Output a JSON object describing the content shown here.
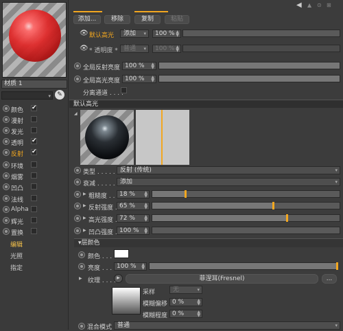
{
  "left": {
    "material_name": "材质 1",
    "channels": [
      {
        "label": "颜色",
        "checked": true,
        "active": false
      },
      {
        "label": "漫射",
        "checked": false,
        "active": false
      },
      {
        "label": "发光",
        "checked": false,
        "active": false
      },
      {
        "label": "透明",
        "checked": true,
        "active": false
      },
      {
        "label": "反射",
        "checked": true,
        "active": true
      },
      {
        "label": "环境",
        "checked": false,
        "active": false
      },
      {
        "label": "烟雾",
        "checked": false,
        "active": false
      },
      {
        "label": "凹凸",
        "checked": false,
        "active": false
      },
      {
        "label": "法线",
        "checked": false,
        "active": false
      },
      {
        "label": "Alpha",
        "checked": false,
        "active": false
      },
      {
        "label": "辉光",
        "checked": false,
        "active": false
      },
      {
        "label": "置换",
        "checked": false,
        "active": false
      }
    ],
    "sub_items": [
      "编辑",
      "光照",
      "指定"
    ],
    "selected_sub": "编辑"
  },
  "toolbar": {
    "add": "添加...",
    "remove": "移除",
    "copy": "复制",
    "paste": "粘贴"
  },
  "layers": {
    "layer1": {
      "name": "默认高光",
      "mode": "添加",
      "percent": "100 %"
    },
    "layer2": {
      "name": "* 透明度 *",
      "mode": "普通",
      "percent": "100 %"
    }
  },
  "global": {
    "reflection_label": "全局反射亮度",
    "reflection_value": "100 %",
    "specular_label": "全局高光亮度",
    "specular_value": "100 %",
    "separate_label": "分离通道 . . . ."
  },
  "layer_section": {
    "title": "默认高光"
  },
  "props": {
    "type_label": "类型 . . . . .",
    "type_value": "反射 (传统)",
    "atten_label": "衰减 . . . . .",
    "atten_value": "添加",
    "rough_label": "粗糙度 . . .",
    "rough_value": "18 %",
    "rough_level": 18,
    "refl_label": "反射强度 . .",
    "refl_value": "65 %",
    "refl_level": 65,
    "spec_label": "高光强度 . .",
    "spec_value": "72 %",
    "spec_level": 72,
    "bump_label": "凹凸强度 . .",
    "bump_value": "100 %",
    "bump_level": 0
  },
  "layer_color": {
    "title": "层颜色",
    "color_label": "颜色 . . . . .",
    "color_value": "#ffffff",
    "brightness_label": "亮度 . . . . .",
    "brightness_value": "100 %",
    "brightness_level": 100,
    "texture_label": "纹理 . . . .",
    "texture_value": "菲涅耳(Fresnel)",
    "texture_more": "...",
    "sampling_label": "采样",
    "sampling_value": "无",
    "blur_offset_label": "模糊偏移",
    "blur_offset_value": "0 %",
    "blur_scale_label": "模糊程度",
    "blur_scale_value": "0 %",
    "mix_label": "混合模式",
    "mix_value": "普通"
  },
  "colors": {
    "accent": "#f3a71f",
    "panel": "#3c3c3c",
    "dark": "#2f2f2f"
  }
}
